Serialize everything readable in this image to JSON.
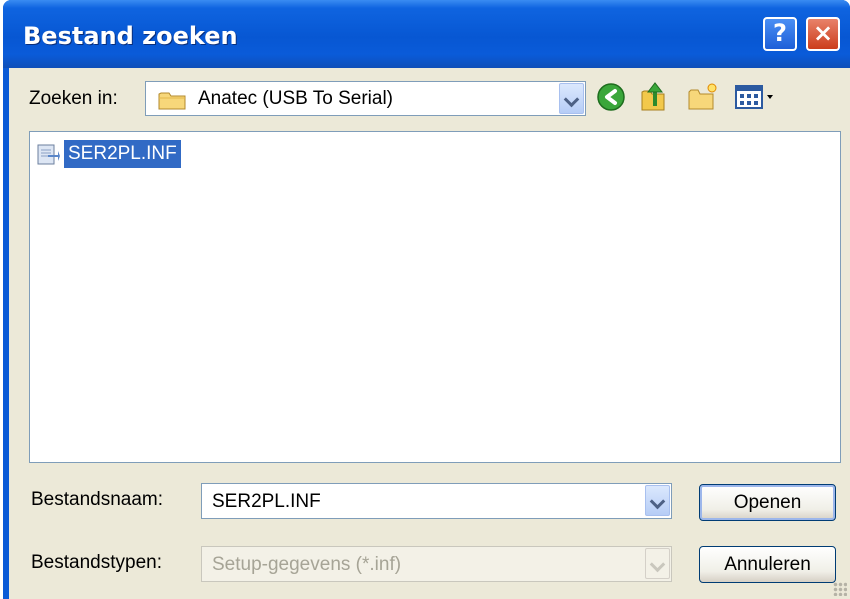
{
  "window": {
    "title": "Bestand zoeken"
  },
  "title_buttons": {
    "help": "?",
    "close": "×"
  },
  "lookin": {
    "label": "Zoeken in:",
    "value": "Anatec (USB To Serial)"
  },
  "toolbar": {
    "icons": [
      "back-icon",
      "up-folder-icon",
      "new-folder-icon",
      "view-menu-icon"
    ]
  },
  "files": [
    {
      "name": "SER2PL.INF",
      "icon": "setup-info-file-icon",
      "selected": true
    }
  ],
  "filename": {
    "label": "Bestandsnaam:",
    "value": "SER2PL.INF"
  },
  "filetype": {
    "label": "Bestandstypen:",
    "value": "Setup-gegevens (*.inf)"
  },
  "buttons": {
    "open": "Openen",
    "cancel": "Annuleren"
  },
  "colors": {
    "titlebar": "#0757d3",
    "client": "#ece9d8",
    "selection": "#316ac5",
    "close_button": "#cc3d1c"
  }
}
